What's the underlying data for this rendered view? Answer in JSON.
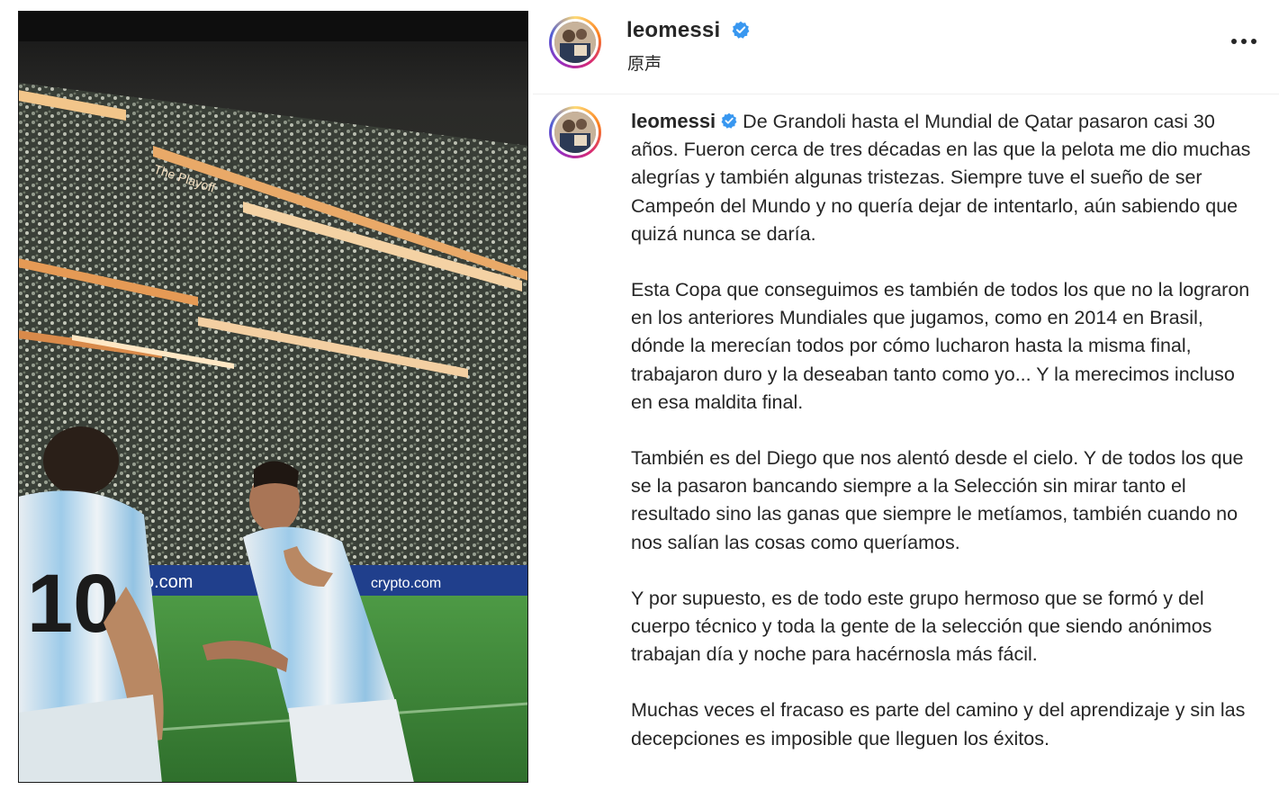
{
  "header": {
    "username": "leomessi",
    "audio_label": "原声",
    "more_icon": "more-horizontal-icon",
    "verified_icon": "verified-badge-icon"
  },
  "caption": {
    "username": "leomessi",
    "paragraphs": [
      "De Grandoli hasta el Mundial de Qatar pasaron casi 30 años. Fueron cerca de tres décadas en las que la pelota me dio muchas alegrías y también algunas tristezas. Siempre tuve el sueño de ser Campeón del Mundo y no quería dejar de intentarlo, aún sabiendo que quizá nunca se daría.",
      "Esta Copa que conseguimos es también de todos los que no la lograron en los anteriores Mundiales que jugamos, como en 2014 en Brasil, dónde la merecían todos por cómo lucharon hasta la misma final, trabajaron duro y la deseaban tanto como yo... Y la merecimos incluso en esa maldita final.",
      "También es del Diego que nos alentó desde el cielo. Y de todos los que se la pasaron bancando siempre a la Selección sin mirar tanto el resultado sino las ganas que siempre le metíamos, también cuando no nos salían las cosas como queríamos.",
      "Y por supuesto, es de todo este grupo hermoso que se formó y del cuerpo técnico y toda la gente de la selección que siendo anónimos trabajan día y noche para hacérnosla más fácil.",
      "Muchas veces el fracaso es parte del camino y del aprendizaje y sin las decepciones es imposible que lleguen los éxitos."
    ]
  },
  "media": {
    "board_text_1": "The Playoff",
    "board_text_2": "ito.com",
    "board_text_3": "crypto.com",
    "jersey_number": "10",
    "colors": {
      "stadium_dark": "#232a24",
      "pitch": "#3e8a3a",
      "jersey_blue": "#8fc3e6",
      "board": "#1e3c8a"
    }
  },
  "colors": {
    "verified_blue": "#3897f0",
    "text": "#262626"
  }
}
